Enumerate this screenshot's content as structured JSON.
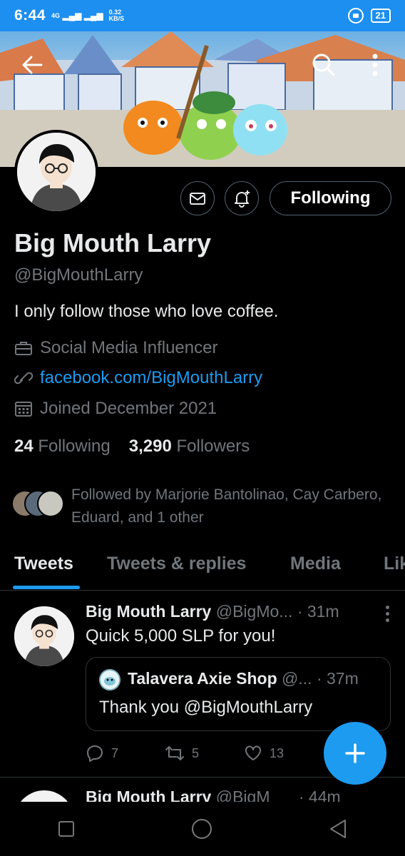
{
  "status_bar": {
    "time": "6:44",
    "signal": "4G",
    "speed_value": "0.32",
    "speed_unit": "KB/S",
    "battery": "21"
  },
  "profile": {
    "name": "Big Mouth Larry",
    "handle": "@BigMouthLarry",
    "bio": "I only follow those who love coffee.",
    "category": "Social Media Influencer",
    "website": "facebook.com/BigMouthLarry",
    "joined": "Joined December 2021",
    "following_count": "24",
    "following_label": "Following",
    "followers_count": "3,290",
    "followers_label": "Followers",
    "followed_by": "Followed by Marjorie Bantolinao, Cay Carbero, Eduard, and 1 other",
    "follow_button": "Following"
  },
  "tabs": [
    {
      "label": "Tweets",
      "active": true
    },
    {
      "label": "Tweets & replies",
      "active": false
    },
    {
      "label": "Media",
      "active": false
    },
    {
      "label": "Lik",
      "active": false
    }
  ],
  "tweets": [
    {
      "author": "Big Mouth Larry",
      "handle": "@BigMo...",
      "time": "· 31m",
      "text": "Quick 5,000 SLP for you!",
      "quote": {
        "author": "Talavera Axie Shop",
        "handle": "@...",
        "time": "· 37m",
        "text": "Thank you @BigMouthLarry"
      },
      "replies": "7",
      "retweets": "5",
      "likes": "13"
    },
    {
      "author": "Big Mouth Larry",
      "handle": "@BigM",
      "time": "· 44m"
    }
  ],
  "colors": {
    "accent": "#1d9bf0",
    "status_bar": "#1d8ff0",
    "muted": "#71767b",
    "background": "#000000"
  },
  "icons": [
    "back-arrow-icon",
    "search-icon",
    "more-vertical-icon",
    "mail-icon",
    "bell-plus-icon",
    "briefcase-icon",
    "link-icon",
    "calendar-icon",
    "reply-icon",
    "retweet-icon",
    "like-icon",
    "compose-plus-icon"
  ]
}
